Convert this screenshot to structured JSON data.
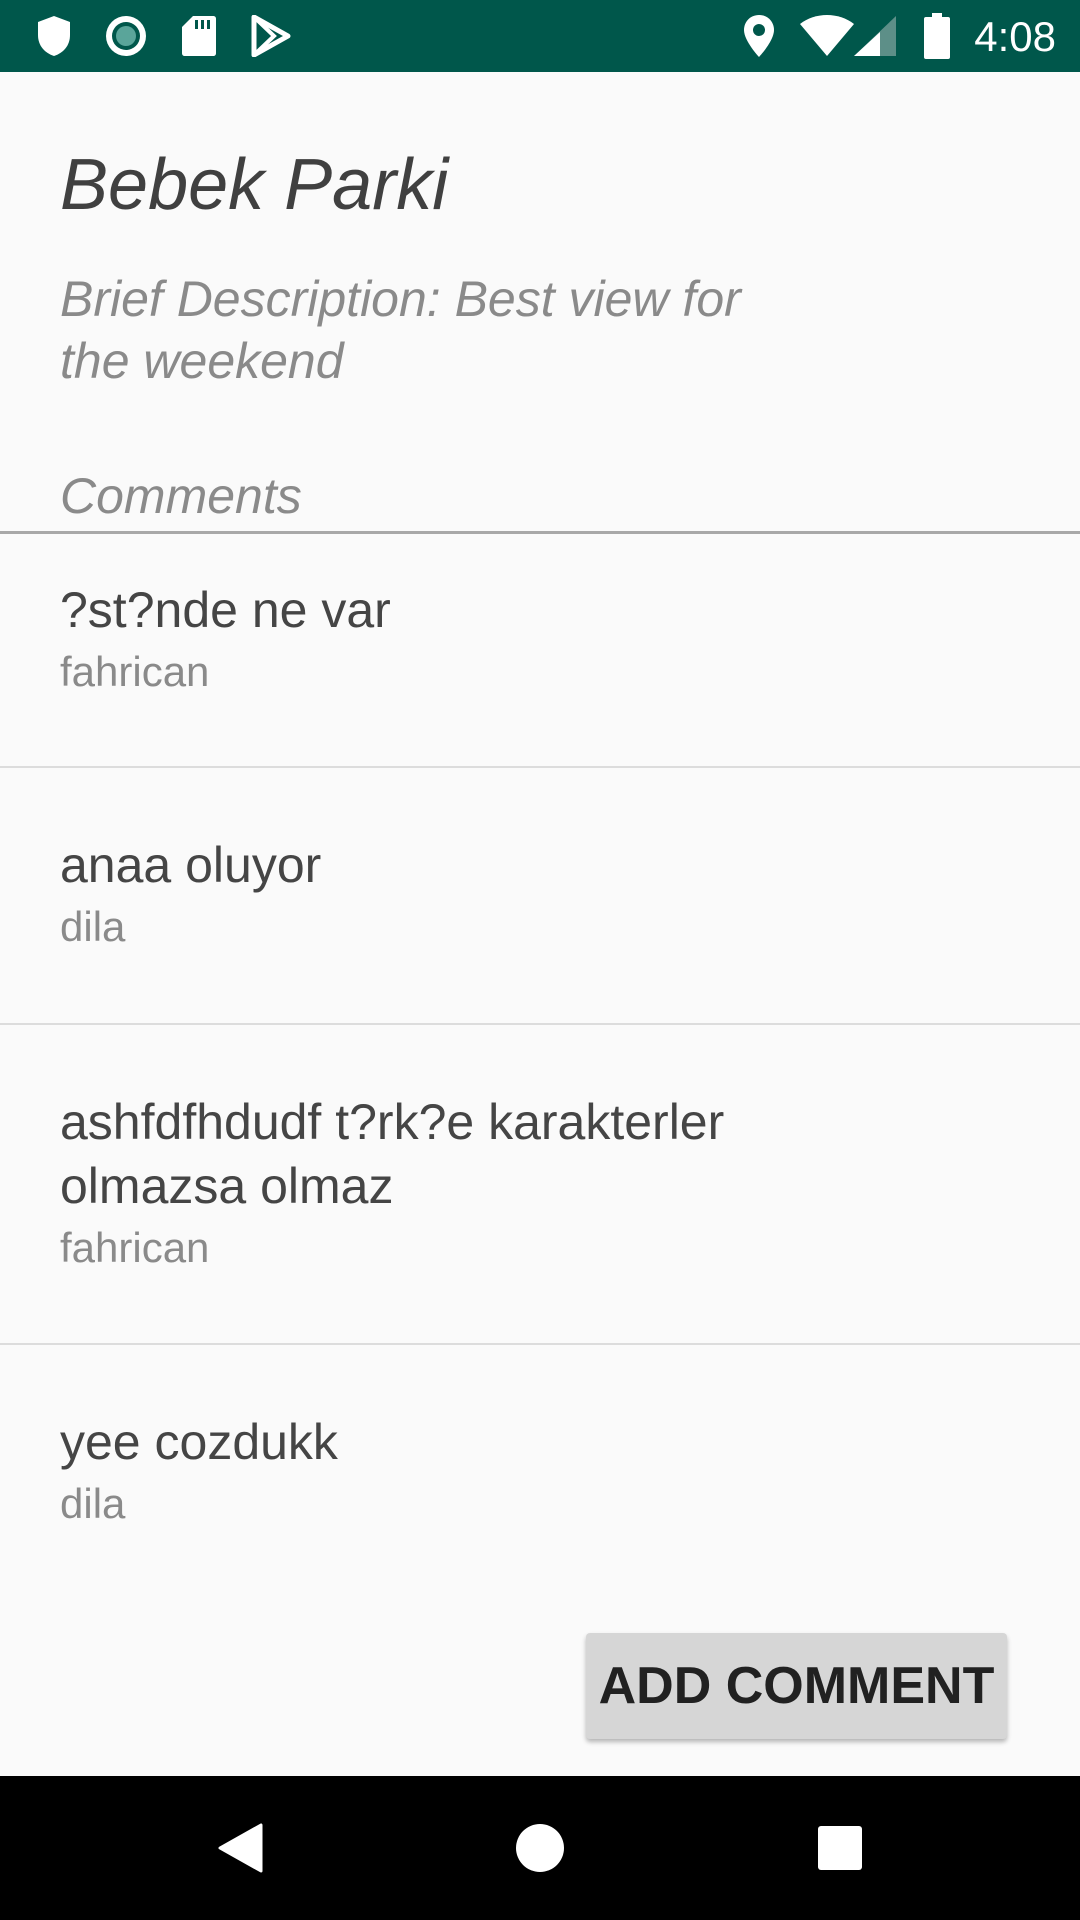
{
  "status_bar": {
    "time": "4:08",
    "left_icons": [
      "shield-icon",
      "record-icon",
      "sd-card-icon",
      "play-store-icon"
    ],
    "right_icons": [
      "location-icon",
      "wifi-icon",
      "signal-icon",
      "battery-icon"
    ],
    "background": "#00574b"
  },
  "place": {
    "title": "Bebek Parki",
    "description": "Brief Description: Best view for the weekend"
  },
  "comments": {
    "heading": "Comments",
    "items": [
      {
        "text": "?st?nde ne var",
        "author": "fahrican"
      },
      {
        "text": "anaa oluyor",
        "author": "dila"
      },
      {
        "text": "ashfdfhdudf t?rk?e karakterler olmazsa olmaz",
        "author": "fahrican"
      },
      {
        "text": "yee cozdukk",
        "author": "dila"
      }
    ]
  },
  "actions": {
    "add_comment_label": "ADD COMMENT"
  },
  "nav_bar": {
    "icons": [
      "back-icon",
      "home-icon",
      "recents-icon"
    ]
  }
}
